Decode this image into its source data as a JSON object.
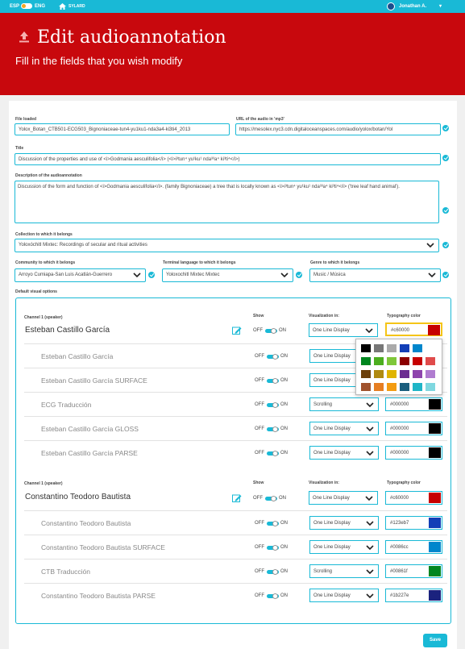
{
  "topbar": {
    "lang_esp": "ESP",
    "lang_eng": "ENG",
    "home_label": "SYLARD",
    "user_name": "Jonathan A."
  },
  "header": {
    "title": "Edit audioannotation",
    "subtitle": "Fill in the fields that you wish modify"
  },
  "form": {
    "file_loaded_label": "File loaded",
    "file_loaded_value": "Yolox_Botan_CTB501-ECG503_Bignoniaceae-tun4-yu1ku1-nda3a4-ki3ti4_2013",
    "audio_url_label": "URL of the audio in 'mp3'",
    "audio_url_value": "https://mesolex.nyc3.cdn.digitaloceanspaces.com/audio/yolox/botan/Yol",
    "title_label": "Title",
    "title_value": "Discussion of the properties and use of <i>Godmania aesculifolia</i> (<i>i³tun⁴ yu¹ku¹ nda³³a⁴ ki³ti⁴</i>)",
    "description_label": "Description of the audioannotation",
    "description_value": "Discussion of the form and function of <i>Godmania aesculifolia</i>. (family Bignoniaceae) a tree that is locally known as <i>i³tun⁴ yu¹ku¹ nda³³a⁴ ki³ti⁴</i> ('tree leaf hand animal').",
    "collection_label": "Collection to which it belongs",
    "collection_value": "Yoloxóchitl Mixtec: Recordings of secular and ritual activities",
    "community_label": "Community to which it belongs",
    "community_value": "Arroyo Cumiapa-San Luis Acatlán-Guerrero",
    "language_label": "Terminal language to which it belongs",
    "language_value": "Yoloxochitl Mixtec Mixtec",
    "genre_label": "Genre to which it belongs",
    "genre_value": "Music / Música",
    "visual_label": "Default visual options"
  },
  "visual": {
    "show_head": "Show",
    "viz_head": "Visualization in:",
    "typo_head": "Typography color",
    "off": "OFF",
    "on": "ON",
    "channel1": {
      "label": "Channel 1 (speaker)",
      "speaker": "Esteban Castillo García",
      "viz": "One Line Display",
      "color": "#c60000",
      "color_swatch": "#c60000",
      "tiers": [
        {
          "name": "Esteban Castillo García",
          "viz": "One Line Display",
          "color": "",
          "swatch": "#000000"
        },
        {
          "name": "Esteban Castillo García SURFACE",
          "viz": "One Line Display",
          "color": "",
          "swatch": "#000000"
        },
        {
          "name": "ECG Traducción",
          "viz": "Scrolling",
          "color": "#000000",
          "swatch": "#000000"
        },
        {
          "name": "Esteban Castillo García GLOSS",
          "viz": "One Line Display",
          "color": "#000000",
          "swatch": "#000000"
        },
        {
          "name": "Esteban Castillo García PARSE",
          "viz": "One Line Display",
          "color": "#000000",
          "swatch": "#000000"
        }
      ]
    },
    "channel2": {
      "label": "Channel 1 (speaker)",
      "speaker": "Constantino Teodoro Bautista",
      "viz": "One Line Display",
      "color": "#c60000",
      "color_swatch": "#c60000",
      "tiers": [
        {
          "name": "Constantino Teodoro Bautista",
          "viz": "One Line Display",
          "color": "#123eb7",
          "swatch": "#123eb7"
        },
        {
          "name": "Constantino Teodoro Bautista SURFACE",
          "viz": "One Line Display",
          "color": "#0086cc",
          "swatch": "#0086cc"
        },
        {
          "name": "CTB Traducción",
          "viz": "Scrolling",
          "color": "#00861f",
          "swatch": "#00861f"
        },
        {
          "name": "Constantino Teodoro Bautista PARSE",
          "viz": "One Line Display",
          "color": "#1b227e",
          "swatch": "#1b227e"
        }
      ]
    },
    "palette": [
      "#000000",
      "#777777",
      "#aaaaaa",
      "#123eb7",
      "#0086cc",
      "#00861f",
      "#4cae1f",
      "#7fc73a",
      "#8b0000",
      "#c60000",
      "#e04b4b",
      "#6b3f0a",
      "#b08a10",
      "#e0b400",
      "#6b2c91",
      "#8e44ad",
      "#b07cd0",
      "#a0522d",
      "#e67e22",
      "#f39c12",
      "#1b5e7e",
      "#1fb5c7",
      "#7fd8e0"
    ]
  },
  "save_label": "Save",
  "colors": {
    "accent": "#19b9d6",
    "header": "#c8080d"
  }
}
